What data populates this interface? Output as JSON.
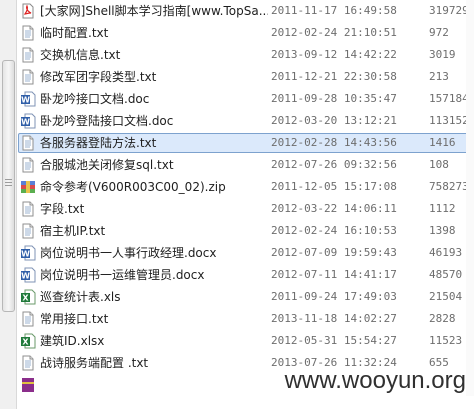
{
  "files": [
    {
      "name": "[大家网]Shell脚本学习指南[www.TopSa...",
      "date": "2011-11-17 16:49:58",
      "size": "31972909",
      "icon": "pdf-icon",
      "selected": false
    },
    {
      "name": "临时配置.txt",
      "date": "2012-02-24 21:10:51",
      "size": "972",
      "icon": "txt-file-icon",
      "selected": false
    },
    {
      "name": "交换机信息.txt",
      "date": "2013-09-12 14:42:22",
      "size": "3019",
      "icon": "txt-file-icon",
      "selected": false
    },
    {
      "name": "修改军团字段类型.txt",
      "date": "2011-12-21 22:30:58",
      "size": "213",
      "icon": "txt-file-icon",
      "selected": false
    },
    {
      "name": "卧龙吟接口文档.doc",
      "date": "2011-09-28 10:35:47",
      "size": "157184",
      "icon": "word-doc-icon",
      "selected": false
    },
    {
      "name": "卧龙吟登陆接口文档.doc",
      "date": "2012-03-20 13:12:21",
      "size": "113152",
      "icon": "word-doc-icon",
      "selected": false
    },
    {
      "name": "各服务器登陆方法.txt",
      "date": "2012-02-28 14:43:56",
      "size": "1416",
      "icon": "txt-file-icon",
      "selected": true
    },
    {
      "name": "合服城池关闭修复sql.txt",
      "date": "2012-07-26 09:32:56",
      "size": "108",
      "icon": "txt-file-icon",
      "selected": false
    },
    {
      "name": "命令参考(V600R003C00_02).zip",
      "date": "2011-12-05 15:17:08",
      "size": "7582734",
      "icon": "zip-archive-icon",
      "selected": false
    },
    {
      "name": "字段.txt",
      "date": "2012-03-22 14:06:11",
      "size": "1112",
      "icon": "txt-file-icon",
      "selected": false
    },
    {
      "name": "宿主机IP.txt",
      "date": "2012-02-24 16:10:53",
      "size": "1398",
      "icon": "txt-file-icon",
      "selected": false
    },
    {
      "name": "岗位说明书一人事行政经理.docx",
      "date": "2012-07-09 19:59:43",
      "size": "46193",
      "icon": "word-doc-icon",
      "selected": false
    },
    {
      "name": "岗位说明书一运维管理员.docx",
      "date": "2012-07-11 14:41:17",
      "size": "48570",
      "icon": "word-doc-icon",
      "selected": false
    },
    {
      "name": "巡查统计表.xls",
      "date": "2011-09-24 17:49:03",
      "size": "21504",
      "icon": "excel-sheet-icon",
      "selected": false
    },
    {
      "name": "常用接口.txt",
      "date": "2013-11-18 14:02:27",
      "size": "2828",
      "icon": "txt-file-icon",
      "selected": false
    },
    {
      "name": "建筑ID.xlsx",
      "date": "2012-05-31 15:54:27",
      "size": "11523",
      "icon": "excel-sheet-icon",
      "selected": false
    },
    {
      "name": "战诗服务端配置 .txt",
      "date": "2013-07-26 11:32:24",
      "size": "655",
      "icon": "txt-file-icon",
      "selected": false
    },
    {
      "name": "",
      "date": "",
      "size": "",
      "icon": "rar-archive-icon",
      "selected": false
    }
  ],
  "watermark": "www.wooyun.org",
  "colors": {
    "selection_fill": "#dbe9fb",
    "selection_border": "#7da2ce",
    "meta_text": "#6d6d6d"
  }
}
